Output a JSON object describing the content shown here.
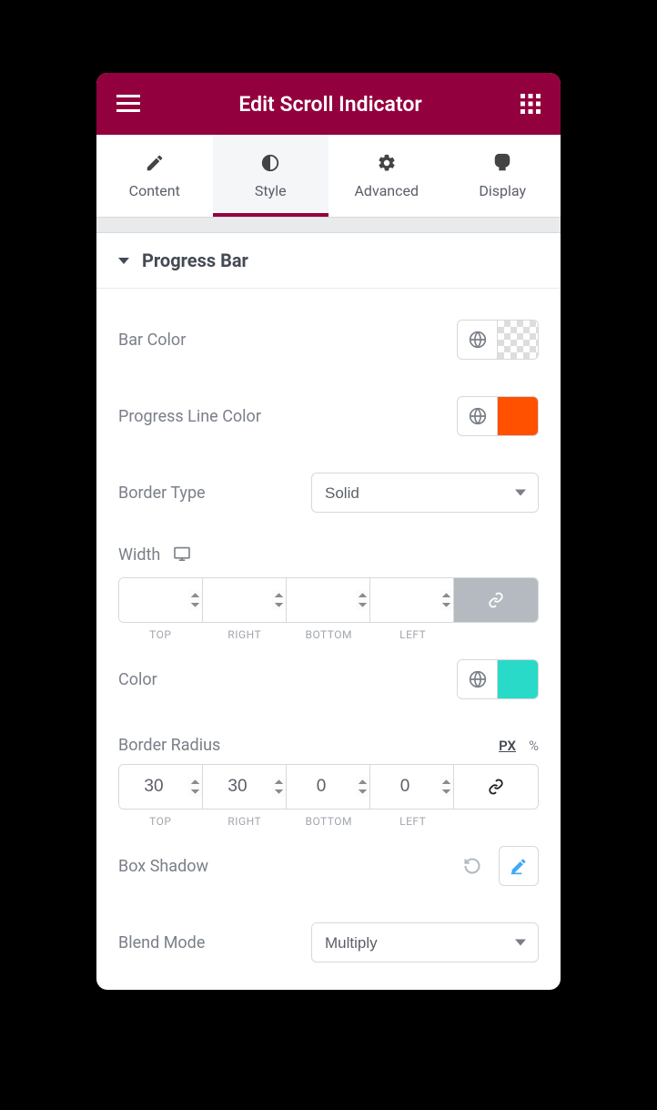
{
  "header": {
    "title": "Edit Scroll Indicator"
  },
  "tabs": [
    {
      "label": "Content"
    },
    {
      "label": "Style"
    },
    {
      "label": "Advanced"
    },
    {
      "label": "Display"
    }
  ],
  "section": {
    "title": "Progress Bar"
  },
  "controls": {
    "bar_color": {
      "label": "Bar Color",
      "value_hex": ""
    },
    "progress_line_color": {
      "label": "Progress Line Color",
      "value_hex": "#FF5100"
    },
    "border_type": {
      "label": "Border Type",
      "value": "Solid"
    },
    "width": {
      "label": "Width",
      "sides": {
        "top": "TOP",
        "right": "RIGHT",
        "bottom": "BOTTOM",
        "left": "LEFT"
      },
      "values": {
        "top": "",
        "right": "",
        "bottom": "",
        "left": ""
      }
    },
    "color": {
      "label": "Color",
      "value_hex": "#2ADAC8"
    },
    "border_radius": {
      "label": "Border Radius",
      "units": {
        "active": "PX",
        "other": "%"
      },
      "sides": {
        "top": "TOP",
        "right": "RIGHT",
        "bottom": "BOTTOM",
        "left": "LEFT"
      },
      "values": {
        "top": "30",
        "right": "30",
        "bottom": "0",
        "left": "0"
      }
    },
    "box_shadow": {
      "label": "Box Shadow"
    },
    "blend_mode": {
      "label": "Blend Mode",
      "value": "Multiply"
    }
  }
}
